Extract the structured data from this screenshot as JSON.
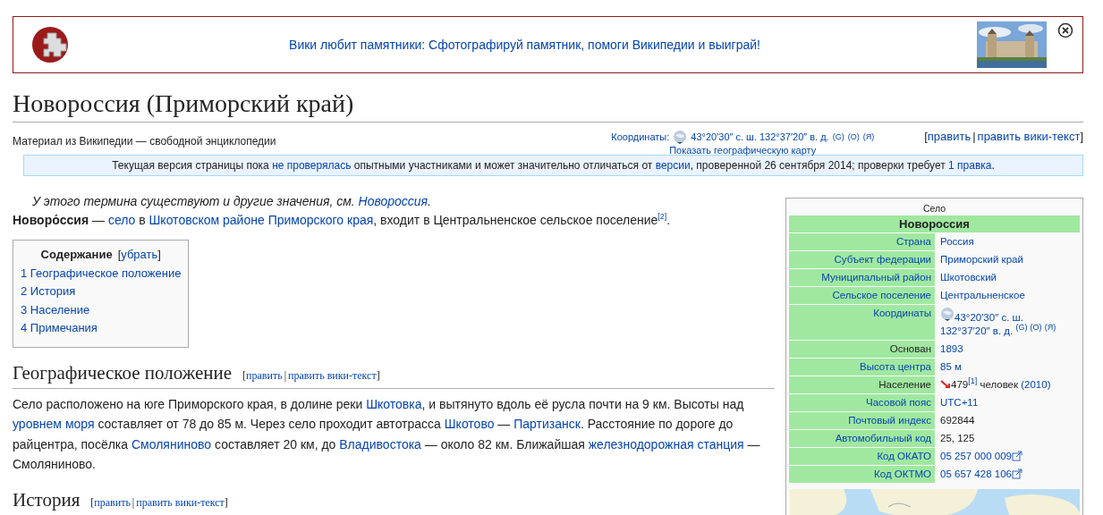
{
  "banner": {
    "message": "Вики любит памятники: Сфотографируй памятник, помоги Википедии и выиграй!"
  },
  "title": "Новороссия (Приморский край)",
  "tagline": "Материал из Википедии — свободной энциклопедии",
  "coordinates": {
    "label": "Координаты:",
    "value": "43°20′30″ с. ш. 132°37′20″ в. д.",
    "sources": [
      "(G)",
      "(O)",
      "(Я)"
    ],
    "map_link": "Показать географическую карту"
  },
  "edit_links": [
    {
      "kind": "bracket",
      "text": "["
    },
    {
      "kind": "link",
      "text": "править"
    },
    {
      "kind": "separator",
      "text": "|"
    },
    {
      "kind": "link",
      "text": "править вики-текст"
    },
    {
      "kind": "bracket",
      "text": "]"
    }
  ],
  "notice": [
    {
      "kind": "text",
      "text": "Текущая версия страницы пока "
    },
    {
      "kind": "link",
      "text": "не проверялась"
    },
    {
      "kind": "text",
      "text": " опытными участниками и может значительно отличаться от "
    },
    {
      "kind": "link",
      "text": "версии"
    },
    {
      "kind": "text",
      "text": ", проверенной 26 сентября 2014; проверки требует "
    },
    {
      "kind": "link",
      "text": "1 правка"
    },
    {
      "kind": "text",
      "text": "."
    }
  ],
  "hatnote": [
    {
      "kind": "text",
      "text": "У этого термина существуют и другие значения, см. "
    },
    {
      "kind": "link",
      "text": "Новороссия"
    },
    {
      "kind": "text",
      "text": "."
    }
  ],
  "lead": [
    {
      "kind": "bold",
      "text": "Новоро́ссия"
    },
    {
      "kind": "text",
      "text": " — "
    },
    {
      "kind": "link",
      "text": "село"
    },
    {
      "kind": "text",
      "text": " в "
    },
    {
      "kind": "link",
      "text": "Шкотовском районе"
    },
    {
      "kind": "link",
      "text": "Приморского края"
    },
    {
      "kind": "text",
      "text": ", входит в Центральненское сельское поселение"
    },
    {
      "kind": "sup",
      "text": "[2]"
    },
    {
      "kind": "text",
      "text": "."
    }
  ],
  "toc": {
    "title": "Содержание",
    "toggle": [
      {
        "kind": "bracket",
        "text": "["
      },
      {
        "kind": "link",
        "text": "убрать"
      },
      {
        "kind": "bracket",
        "text": "]"
      }
    ],
    "items": [
      {
        "number": "1",
        "text": "Географическое положение"
      },
      {
        "number": "2",
        "text": "История"
      },
      {
        "number": "3",
        "text": "Население"
      },
      {
        "number": "4",
        "text": "Примечания"
      }
    ]
  },
  "sections": [
    {
      "title": "Географическое положение",
      "edit_links": [
        {
          "kind": "bracket",
          "text": "["
        },
        {
          "kind": "link",
          "text": "править"
        },
        {
          "kind": "separator",
          "text": "|"
        },
        {
          "kind": "link",
          "text": "править вики-текст"
        },
        {
          "kind": "bracket",
          "text": "]"
        }
      ],
      "paragraphs": [
        [
          {
            "kind": "text",
            "text": "Село расположено на юге Приморского края, в долине реки "
          },
          {
            "kind": "link",
            "text": "Шкотовка"
          },
          {
            "kind": "text",
            "text": ", и вытянуто вдоль её русла почти на 9 км. Высоты над "
          },
          {
            "kind": "link",
            "text": "уровнем моря"
          },
          {
            "kind": "text",
            "text": " составляет от 78 до 85 м. Через село проходит автотрасса "
          },
          {
            "kind": "link",
            "text": "Шкотово"
          },
          {
            "kind": "text",
            "text": " — "
          },
          {
            "kind": "link",
            "text": "Партизанск"
          },
          {
            "kind": "text",
            "text": ". Расстояние по дороге до райцентра, посёлка "
          },
          {
            "kind": "link",
            "text": "Смоляниново"
          },
          {
            "kind": "text",
            "text": " составляет 20 км, до "
          },
          {
            "kind": "link",
            "text": "Владивостока"
          },
          {
            "kind": "text",
            "text": " — около 82 км. Ближайшая "
          },
          {
            "kind": "link",
            "text": "железнодорожная станция"
          },
          {
            "kind": "text",
            "text": " — Смоляниново."
          }
        ]
      ]
    },
    {
      "title": "История",
      "edit_links": [
        {
          "kind": "bracket",
          "text": "["
        },
        {
          "kind": "link",
          "text": "править"
        },
        {
          "kind": "separator",
          "text": "|"
        },
        {
          "kind": "link",
          "text": "править вики-текст"
        },
        {
          "kind": "bracket",
          "text": "]"
        }
      ]
    }
  ],
  "infobox": {
    "type": "Село",
    "name": "Новороссия",
    "rows": [
      {
        "label": "Страна",
        "link": true,
        "value": [
          {
            "kind": "link",
            "text": "Россия"
          }
        ]
      },
      {
        "label": "Субъект федерации",
        "link": true,
        "value": [
          {
            "kind": "link",
            "text": "Приморский край"
          }
        ]
      },
      {
        "label": "Муниципальный район",
        "link": true,
        "value": [
          {
            "kind": "link",
            "text": "Шкотовский"
          }
        ]
      },
      {
        "label": "Сельское поселение",
        "link": true,
        "value": [
          {
            "kind": "link",
            "text": "Центральненское"
          }
        ]
      },
      {
        "label": "Координаты",
        "link": true,
        "value": [
          {
            "kind": "globe"
          },
          {
            "kind": "link",
            "text": "43°20′30″ с. ш."
          },
          {
            "kind": "link",
            "text": "132°37′20″ в. д."
          },
          {
            "kind": "sup",
            "text": "(G)"
          },
          {
            "kind": "sup",
            "text": "(O)"
          },
          {
            "kind": "sup",
            "text": "(Я)"
          }
        ]
      },
      {
        "label": "Основан",
        "link": false,
        "value": [
          {
            "kind": "link",
            "text": "1893"
          }
        ]
      },
      {
        "label": "Высота центра",
        "link": true,
        "value": [
          {
            "kind": "link",
            "text": "85 м"
          }
        ]
      },
      {
        "label": "Население",
        "link": false,
        "value": [
          {
            "kind": "trend-down"
          },
          {
            "kind": "text",
            "text": "479"
          },
          {
            "kind": "sup",
            "text": "[1]"
          },
          {
            "kind": "text",
            "text": " человек "
          },
          {
            "kind": "link",
            "text": "(2010)"
          }
        ]
      },
      {
        "label": "Часовой пояс",
        "link": true,
        "value": [
          {
            "kind": "link",
            "text": "UTC+11"
          }
        ]
      },
      {
        "label": "Почтовый индекс",
        "link": true,
        "value": [
          {
            "kind": "text",
            "text": "692844"
          }
        ]
      },
      {
        "label": "Автомобильный код",
        "link": true,
        "value": [
          {
            "kind": "text",
            "text": "25, 125"
          }
        ]
      },
      {
        "label": "Код ОКАТО",
        "link": true,
        "value": [
          {
            "kind": "link",
            "text": "05 257 000 009"
          },
          {
            "kind": "external"
          }
        ]
      },
      {
        "label": "Код ОКТМО",
        "link": true,
        "value": [
          {
            "kind": "link",
            "text": "05 657 428 106"
          },
          {
            "kind": "external"
          }
        ]
      }
    ]
  }
}
